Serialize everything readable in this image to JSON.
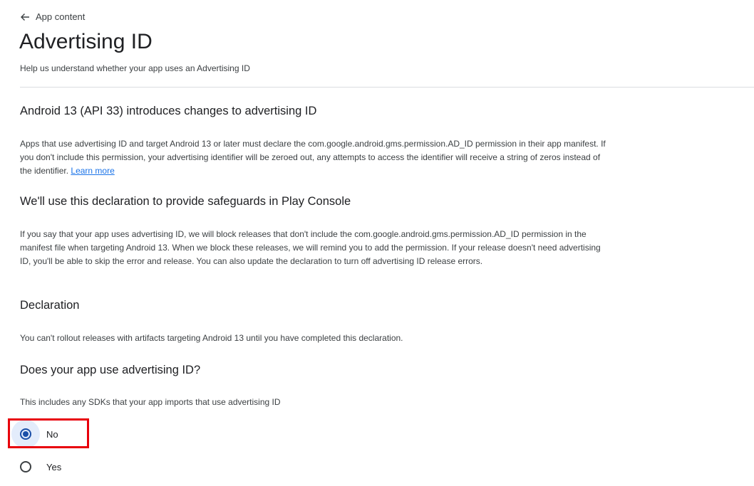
{
  "header": {
    "back_label": "App content",
    "title": "Advertising ID",
    "subtitle": "Help us understand whether your app uses an Advertising ID"
  },
  "sections": [
    {
      "heading": "Android 13 (API 33) introduces changes to advertising ID",
      "body": "Apps that use advertising ID and target Android 13 or later must declare the com.google.android.gms.permission.AD_ID permission in their app manifest. If you don't include this permission, your advertising identifier will be zeroed out, any attempts to access the identifier will receive a string of zeros instead of the identifier.",
      "link": "Learn more"
    },
    {
      "heading": "We'll use this declaration to provide safeguards in Play Console",
      "body": "If you say that your app uses advertising ID, we will block releases that don't include the com.google.android.gms.permission.AD_ID permission in the manifest file when targeting Android 13. When we block these releases, we will remind you to add the permission. If your release doesn't need advertising ID, you'll be able to skip the error and release. You can also update the declaration to turn off advertising ID release errors."
    },
    {
      "heading": "Declaration",
      "body": "You can't rollout releases with artifacts targeting Android 13 until you have completed this declaration."
    },
    {
      "heading": "Does your app use advertising ID?",
      "body": "This includes any SDKs that your app imports that use advertising ID"
    }
  ],
  "question": {
    "options": [
      {
        "label": "No",
        "selected": true
      },
      {
        "label": "Yes",
        "selected": false
      }
    ]
  },
  "icons": {
    "back": "arrow-left-icon",
    "radio_checked": "radio-checked-icon",
    "radio_unchecked": "radio-unchecked-icon"
  },
  "colors": {
    "link": "#1a73e8",
    "radio_selected": "#1a4fa8",
    "highlight": "#e8000b"
  }
}
